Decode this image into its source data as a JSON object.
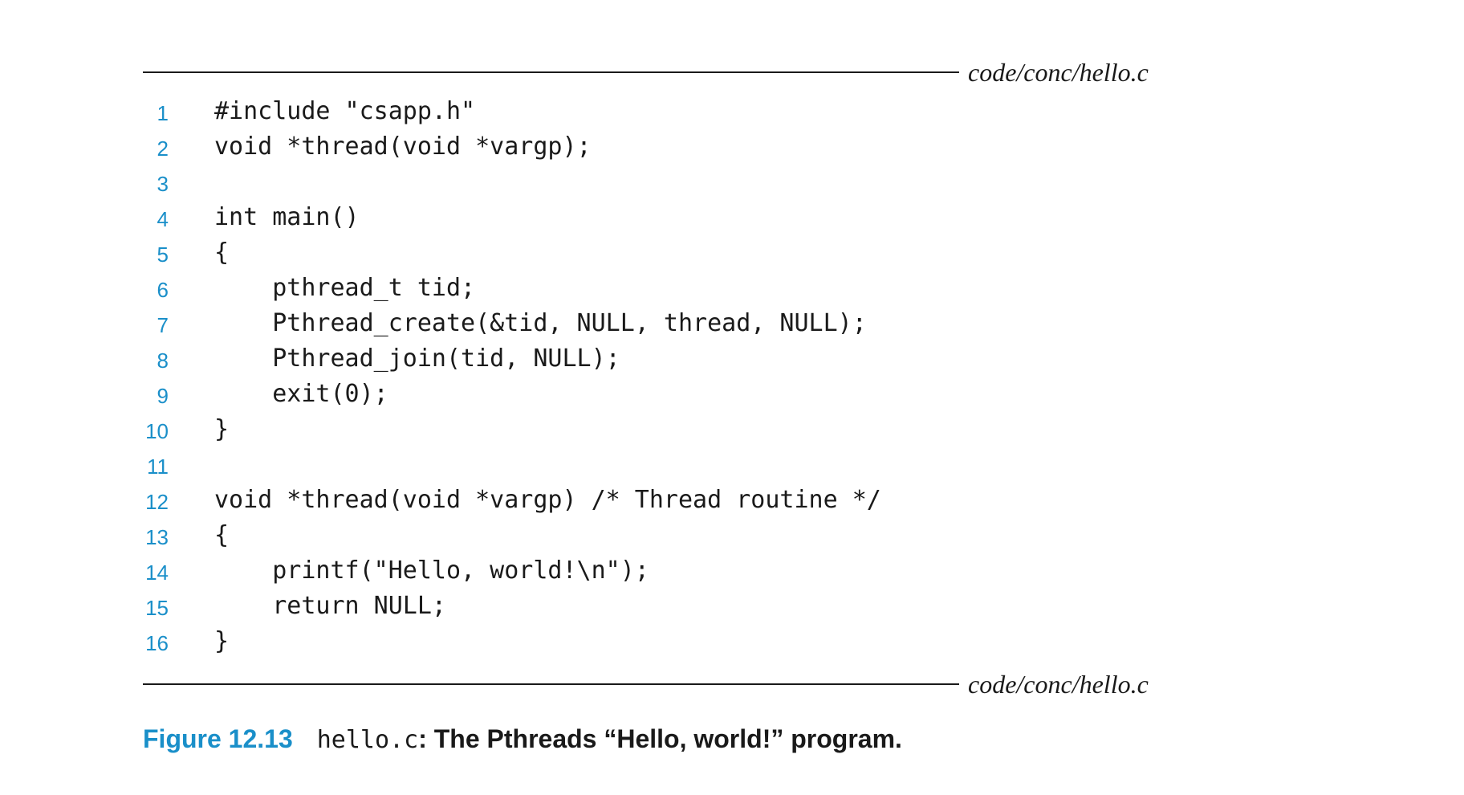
{
  "listing": {
    "filename_top": "code/conc/hello.c",
    "filename_bottom": "code/conc/hello.c",
    "lines": [
      {
        "n": "1",
        "code": "#include \"csapp.h\""
      },
      {
        "n": "2",
        "code": "void *thread(void *vargp);"
      },
      {
        "n": "3",
        "code": ""
      },
      {
        "n": "4",
        "code": "int main()"
      },
      {
        "n": "5",
        "code": "{"
      },
      {
        "n": "6",
        "code": "    pthread_t tid;"
      },
      {
        "n": "7",
        "code": "    Pthread_create(&tid, NULL, thread, NULL);"
      },
      {
        "n": "8",
        "code": "    Pthread_join(tid, NULL);"
      },
      {
        "n": "9",
        "code": "    exit(0);"
      },
      {
        "n": "10",
        "code": "}"
      },
      {
        "n": "11",
        "code": ""
      },
      {
        "n": "12",
        "code": "void *thread(void *vargp) /* Thread routine */"
      },
      {
        "n": "13",
        "code": "{"
      },
      {
        "n": "14",
        "code": "    printf(\"Hello, world!\\n\");"
      },
      {
        "n": "15",
        "code": "    return NULL;"
      },
      {
        "n": "16",
        "code": "}"
      }
    ]
  },
  "caption": {
    "label": "Figure 12.13",
    "file": "hello.c",
    "text": ": The Pthreads “Hello, world!” program."
  },
  "colors": {
    "accent": "#1a8fc9",
    "text": "#1a1a1a"
  }
}
